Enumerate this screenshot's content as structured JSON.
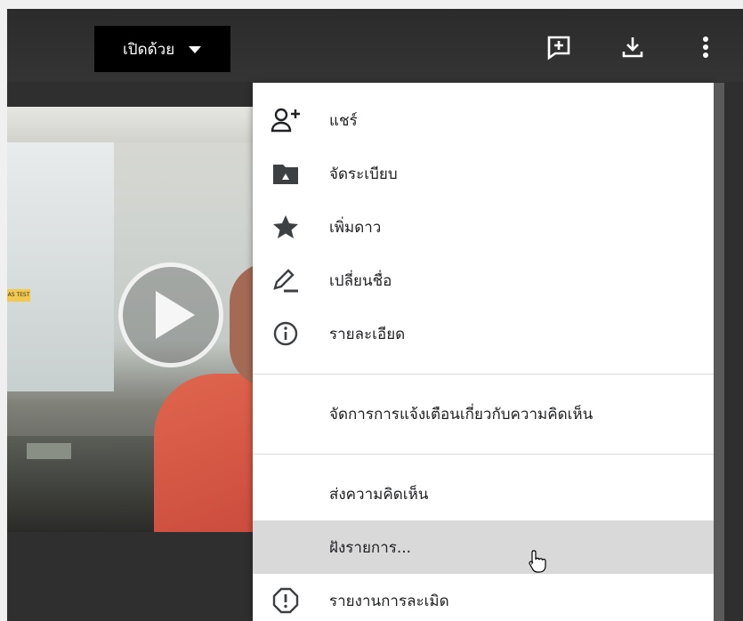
{
  "toolbar": {
    "open_with_label": "เปิดด้วย",
    "icons": [
      "add-comment-icon",
      "download-icon",
      "more-vert-icon"
    ]
  },
  "video": {
    "play_icon": "play-icon",
    "sign_text": "AS TEST"
  },
  "menu": {
    "items": [
      {
        "label": "แชร์",
        "icon": "person-add-icon"
      },
      {
        "label": "จัดระเบียบ",
        "icon": "drive-folder-icon"
      },
      {
        "label": "เพิ่มดาว",
        "icon": "star-icon"
      },
      {
        "label": "เปลี่ยนชื่อ",
        "icon": "pencil-icon"
      },
      {
        "label": "รายละเอียด",
        "icon": "info-icon"
      },
      {
        "label": "จัดการการแจ้งเตือนเกี่ยวกับความคิดเห็น",
        "icon": ""
      },
      {
        "label": "ส่งความคิดเห็น",
        "icon": ""
      },
      {
        "label": "ฝังรายการ...",
        "icon": ""
      },
      {
        "label": "รายงานการละเมิด",
        "icon": "report-icon"
      }
    ],
    "highlighted_index": 7
  },
  "colors": {
    "viewer_bg": "#2f2f2f",
    "menu_bg": "#ffffff",
    "highlight": "#d9d9d9",
    "text": "#202124"
  }
}
